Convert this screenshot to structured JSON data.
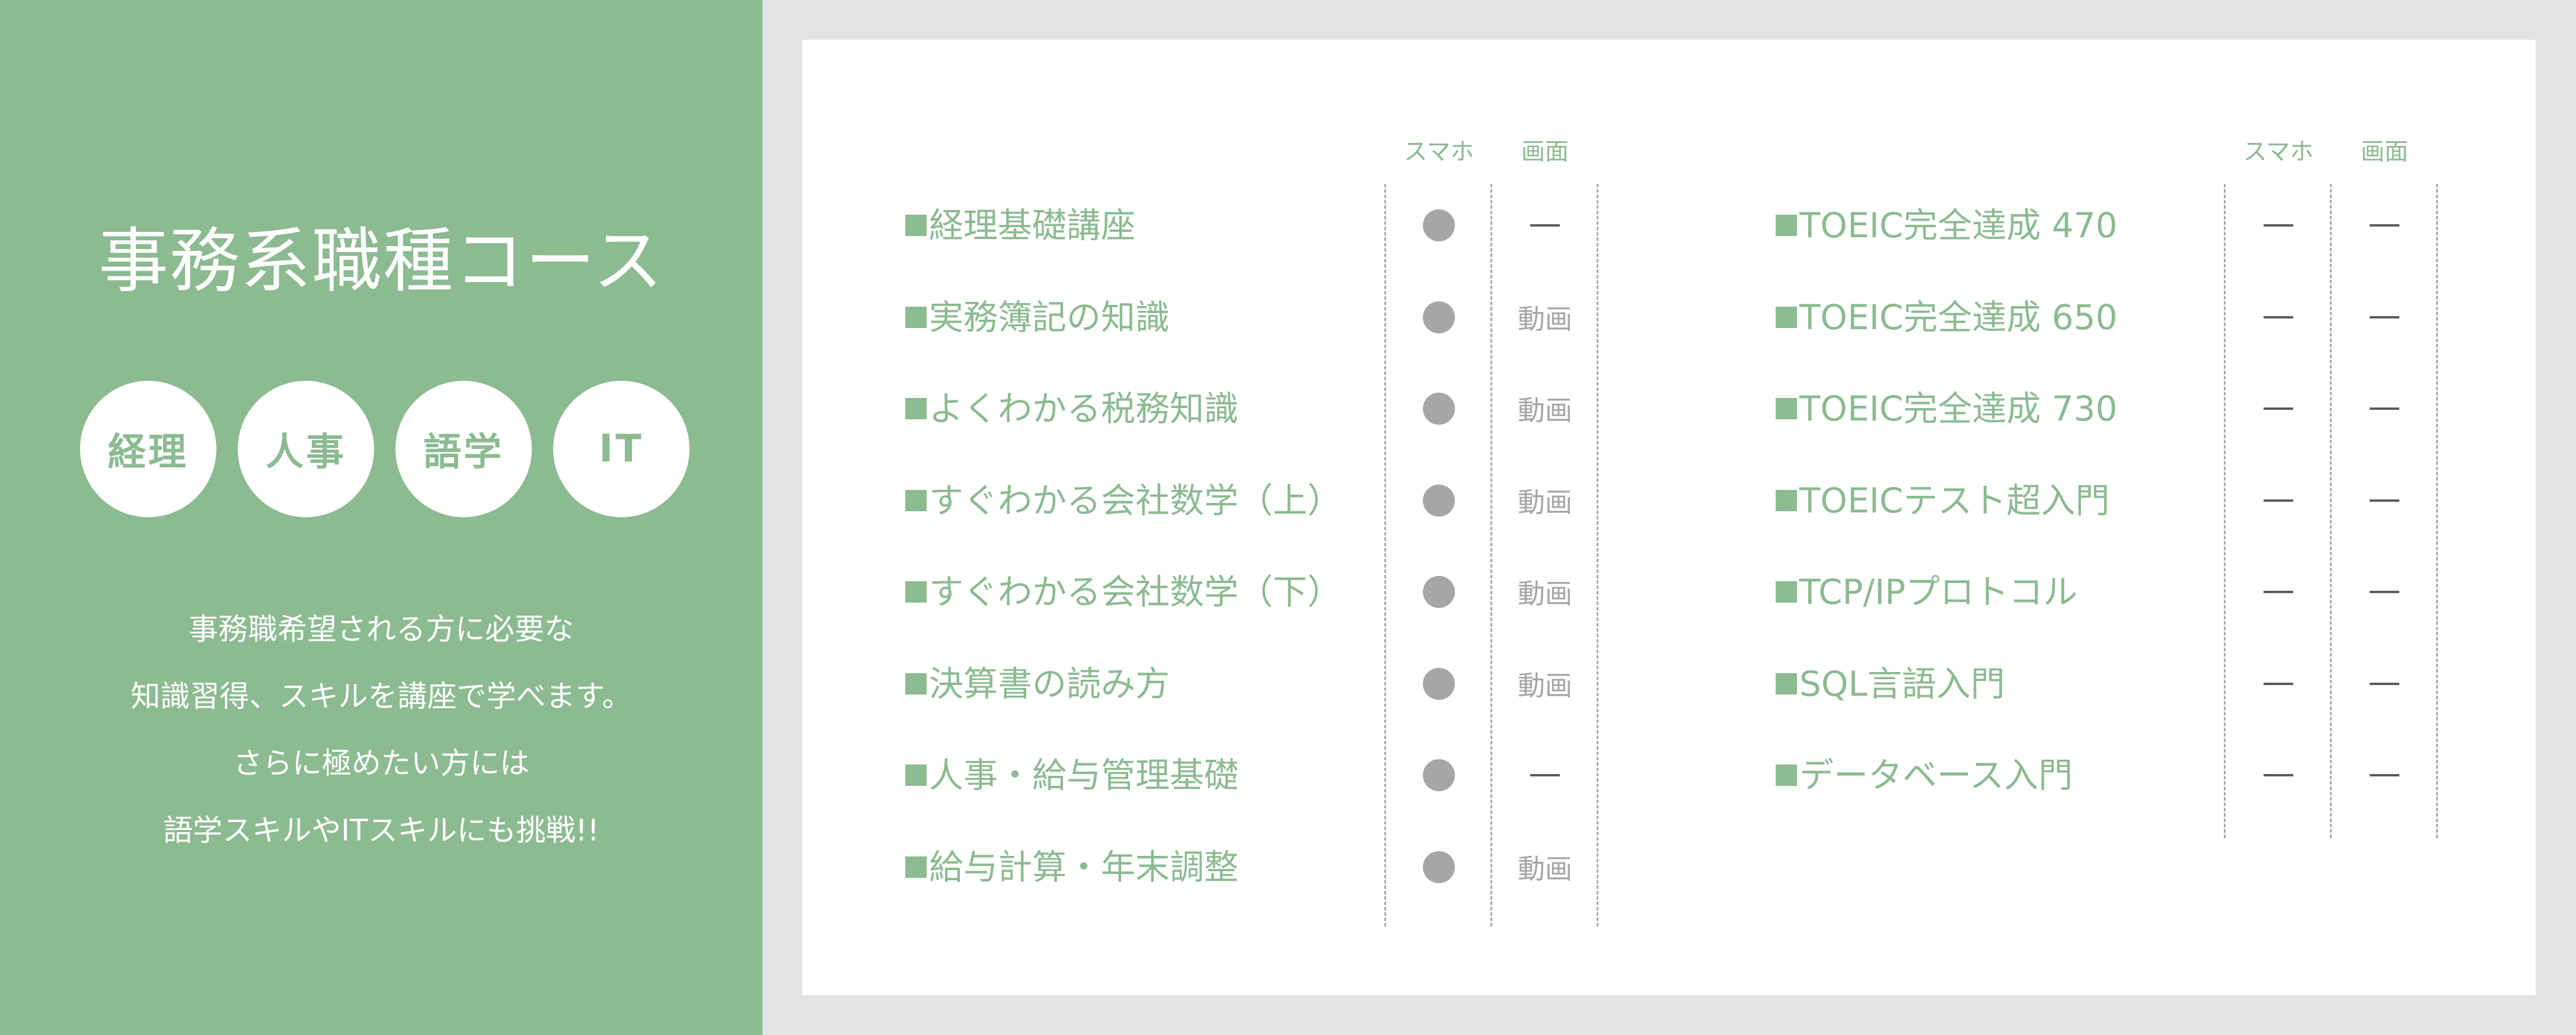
{
  "side": {
    "title": "事務系職種コース",
    "badges": [
      {
        "label": "経理"
      },
      {
        "label": "人事"
      },
      {
        "label": "語学"
      },
      {
        "label": "IT"
      }
    ],
    "description": [
      "事務職希望される方に必要な",
      "知識習得、スキルを講座で学べます。",
      "さらに極めたい方には",
      "語学スキルやITスキルにも挑戦!!"
    ]
  },
  "table_headers": {
    "smartphone": "スマホ",
    "screen": "画面"
  },
  "legend": {
    "available_icon": "filled-circle",
    "unavailable_icon": "dash",
    "video_label": "動画"
  },
  "colors": {
    "accent_green": "#8cba91",
    "background_gray": "#e2e4e3",
    "dot_gray": "#a5a6a5",
    "dash_dark": "#5b5b5b"
  },
  "left_courses": [
    {
      "name": "経理基礎講座",
      "smartphone": "available",
      "screen": "-"
    },
    {
      "name": "実務簿記の知識",
      "smartphone": "available",
      "screen": "動画"
    },
    {
      "name": "よくわかる税務知識",
      "smartphone": "available",
      "screen": "動画"
    },
    {
      "name": "すぐわかる会社数学（上）",
      "smartphone": "available",
      "screen": "動画"
    },
    {
      "name": "すぐわかる会社数学（下）",
      "smartphone": "available",
      "screen": "動画"
    },
    {
      "name": "決算書の読み方",
      "smartphone": "available",
      "screen": "動画"
    },
    {
      "name": "人事・給与管理基礎",
      "smartphone": "available",
      "screen": "-"
    },
    {
      "name": "給与計算・年末調整",
      "smartphone": "available",
      "screen": "動画"
    }
  ],
  "right_courses": [
    {
      "name": "TOEIC完全達成 470",
      "smartphone": "-",
      "screen": "-"
    },
    {
      "name": "TOEIC完全達成 650",
      "smartphone": "-",
      "screen": "-"
    },
    {
      "name": "TOEIC完全達成 730",
      "smartphone": "-",
      "screen": "-"
    },
    {
      "name": "TOEICテスト超入門",
      "smartphone": "-",
      "screen": "-"
    },
    {
      "name": "TCP/IPプロトコル",
      "smartphone": "-",
      "screen": "-"
    },
    {
      "name": "SQL言語入門",
      "smartphone": "-",
      "screen": "-"
    },
    {
      "name": "データベース入門",
      "smartphone": "-",
      "screen": "-"
    }
  ]
}
